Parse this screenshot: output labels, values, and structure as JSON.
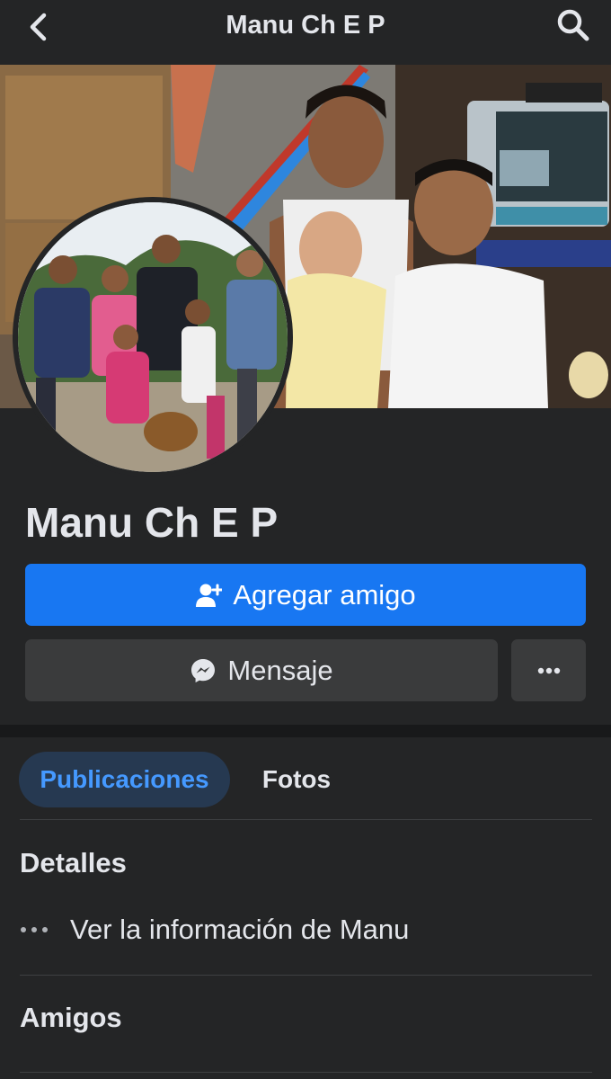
{
  "header": {
    "title": "Manu Ch E P",
    "back_icon": "chevron-left-icon",
    "search_icon": "search-icon"
  },
  "profile": {
    "name": "Manu Ch E P",
    "cover_photo": "cover-photo",
    "profile_photo": "profile-photo"
  },
  "actions": {
    "add_friend_label": "Agregar amigo",
    "add_friend_icon": "add-person-icon",
    "message_label": "Mensaje",
    "message_icon": "messenger-icon",
    "more_icon": "more-horizontal-icon"
  },
  "tabs": [
    {
      "label": "Publicaciones",
      "active": true
    },
    {
      "label": "Fotos",
      "active": false
    }
  ],
  "details": {
    "title": "Detalles",
    "item_label": "Ver la información de Manu",
    "item_icon": "more-dots-icon"
  },
  "friends": {
    "title": "Amigos"
  },
  "colors": {
    "background": "#242526",
    "primary": "#1877f2",
    "secondary_button": "#3a3b3c",
    "active_tab_bg": "#263951",
    "active_tab_text": "#4599ff",
    "text": "#e4e6eb"
  }
}
